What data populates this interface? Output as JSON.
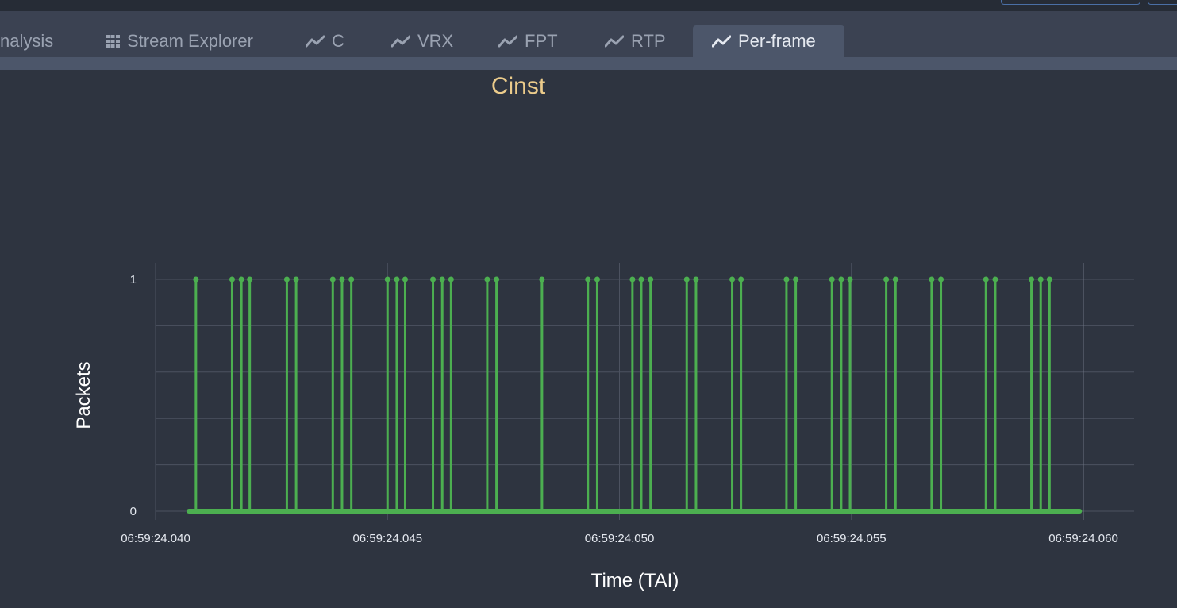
{
  "tabs": [
    {
      "label": "nalysis",
      "icon": "none",
      "active": false
    },
    {
      "label": "Stream Explorer",
      "icon": "grid-icon",
      "active": false
    },
    {
      "label": "C",
      "icon": "line-chart-icon",
      "active": false
    },
    {
      "label": "VRX",
      "icon": "line-chart-icon",
      "active": false
    },
    {
      "label": "FPT",
      "icon": "line-chart-icon",
      "active": false
    },
    {
      "label": "RTP",
      "icon": "line-chart-icon",
      "active": false
    },
    {
      "label": "Per-frame",
      "icon": "line-chart-icon",
      "active": true
    }
  ],
  "colors": {
    "background": "#2e3440",
    "tabbar": "#3b4252",
    "active_tab": "#4c566a",
    "title": "#ebcb8b",
    "series": "#4caf50",
    "grid": "#4c5260"
  },
  "chart_data": {
    "type": "line",
    "title": "Cinst",
    "xlabel": "Time (TAI)",
    "ylabel": "Packets",
    "x_tick_labels": [
      "06:59:24.040",
      "06:59:24.045",
      "06:59:24.050",
      "06:59:24.055",
      "06:59:24.060"
    ],
    "y_tick_labels": [
      "0",
      "1"
    ],
    "xlim_ms": [
      40.0,
      60.0
    ],
    "ylim": [
      0,
      1
    ],
    "grid": true,
    "legend": "none",
    "baseline_range_ms": [
      40.72,
      59.92
    ],
    "spike_times_ms": [
      40.87,
      41.65,
      41.85,
      42.03,
      42.83,
      43.03,
      43.82,
      44.02,
      44.22,
      45.0,
      45.2,
      45.38,
      45.98,
      46.18,
      46.37,
      47.15,
      47.35,
      48.33,
      49.32,
      49.52,
      50.28,
      50.47,
      50.67,
      51.45,
      51.65,
      52.43,
      52.62,
      53.6,
      53.8,
      54.58,
      54.78,
      54.97,
      55.75,
      55.95,
      56.73,
      56.93,
      57.9,
      58.1,
      58.88,
      59.08,
      59.27
    ],
    "spike_value": 1,
    "baseline_value": 0
  }
}
